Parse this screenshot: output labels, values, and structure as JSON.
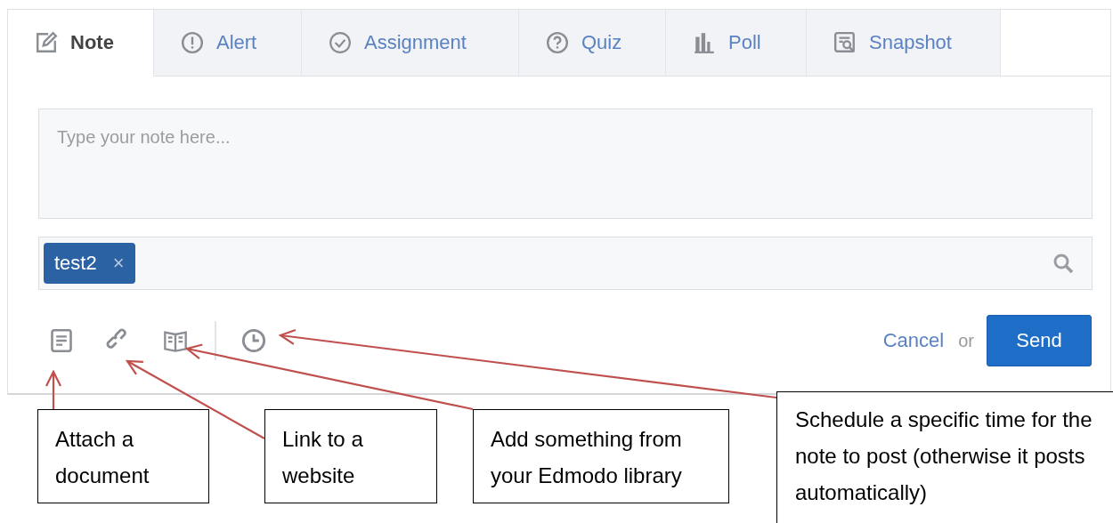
{
  "tabs": [
    {
      "label": "Note",
      "selected": true
    },
    {
      "label": "Alert",
      "selected": false
    },
    {
      "label": "Assignment",
      "selected": false
    },
    {
      "label": "Quiz",
      "selected": false
    },
    {
      "label": "Poll",
      "selected": false
    },
    {
      "label": "Snapshot",
      "selected": false
    }
  ],
  "note_field": {
    "placeholder": "Type your note here..."
  },
  "recipients": {
    "tags": [
      {
        "label": "test2",
        "remove": "×"
      }
    ]
  },
  "actions": {
    "cancel": "Cancel",
    "or": "or",
    "send": "Send"
  },
  "callouts": [
    {
      "text": "Attach a document"
    },
    {
      "text": "Link to a website"
    },
    {
      "text": "Add something from your Edmodo library"
    },
    {
      "text": "Schedule a specific time for the note to post (otherwise it posts automatically)"
    }
  ]
}
